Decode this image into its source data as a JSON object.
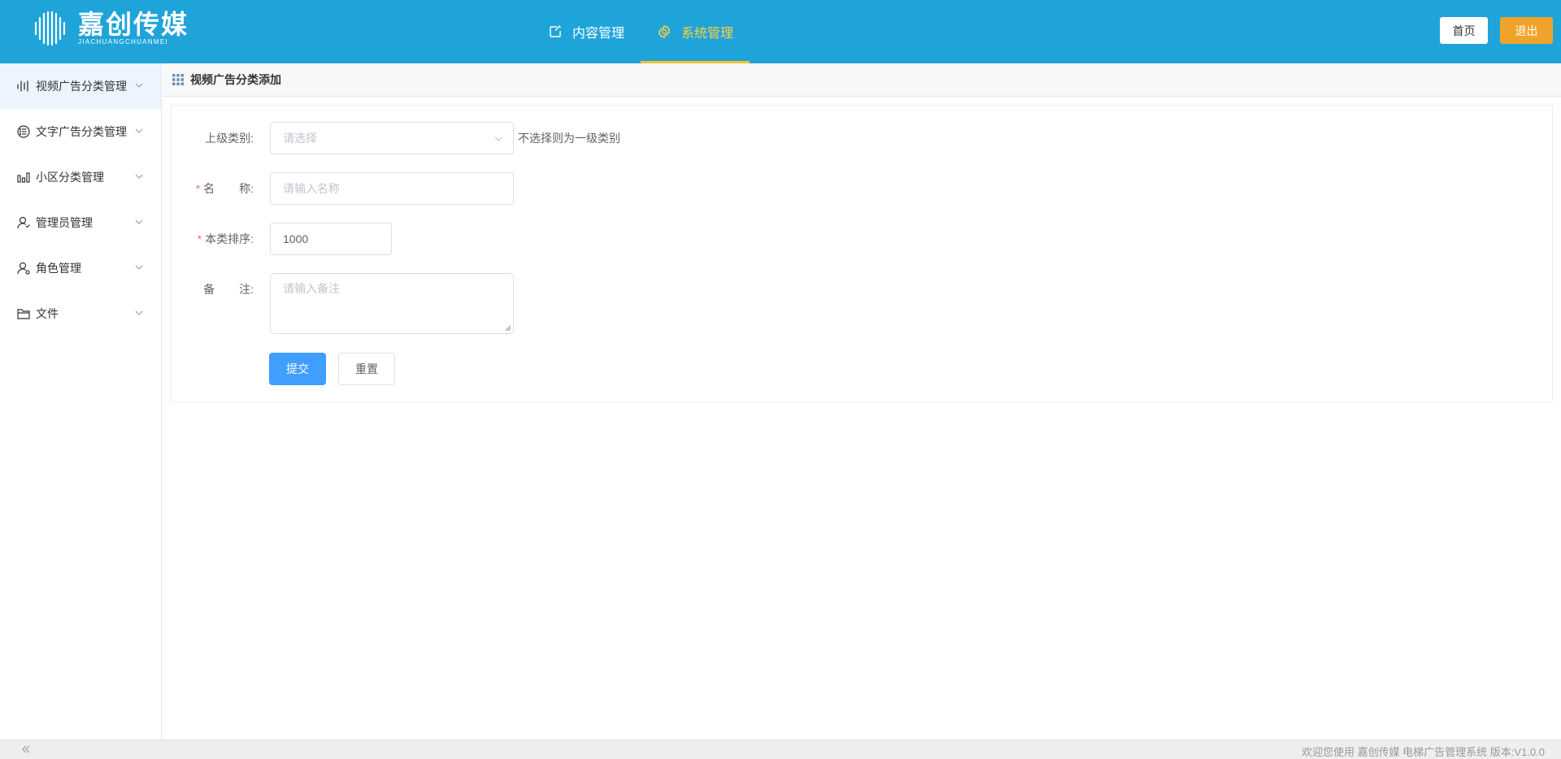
{
  "brand": {
    "title": "嘉创传媒",
    "subtitle": "JIACHUANGCHUANMEI"
  },
  "topnav": [
    {
      "label": "内容管理",
      "icon": "edit-square-icon",
      "active": false
    },
    {
      "label": "系统管理",
      "icon": "gear-icon",
      "active": true
    }
  ],
  "header": {
    "home_label": "首页",
    "exit_label": "退出"
  },
  "sidebar": {
    "items": [
      {
        "label": "视频广告分类管理",
        "icon": "video-bars-icon",
        "active": true
      },
      {
        "label": "文字广告分类管理",
        "icon": "list-circle-icon",
        "active": false
      },
      {
        "label": "小区分类管理",
        "icon": "bar-chart-icon",
        "active": false
      },
      {
        "label": "管理员管理",
        "icon": "user-icon",
        "active": false
      },
      {
        "label": "角色管理",
        "icon": "user-role-icon",
        "active": false
      },
      {
        "label": "文件",
        "icon": "folder-icon",
        "active": false
      }
    ]
  },
  "breadcrumb": {
    "title": "视频广告分类添加"
  },
  "form": {
    "parent": {
      "label": "上级类别:",
      "placeholder": "请选择",
      "hint": "不选择则为一级类别"
    },
    "name": {
      "label_a": "名",
      "label_b": "称:",
      "placeholder": "请输入名称",
      "required": true
    },
    "sort": {
      "label": "本类排序:",
      "value": "1000",
      "required": true
    },
    "remark": {
      "label_a": "备",
      "label_b": "注:",
      "placeholder": "请输入备注"
    },
    "submit_label": "提交",
    "reset_label": "重置"
  },
  "footer": {
    "text": "欢迎您使用 嘉创传媒 电梯广告管理系统  版本:V1.0.0"
  },
  "colors": {
    "header_bg": "#1fa4d9",
    "active_tab": "#ffd040",
    "exit_button": "#f0a32b",
    "primary": "#409eff",
    "required": "#f56c6c"
  }
}
